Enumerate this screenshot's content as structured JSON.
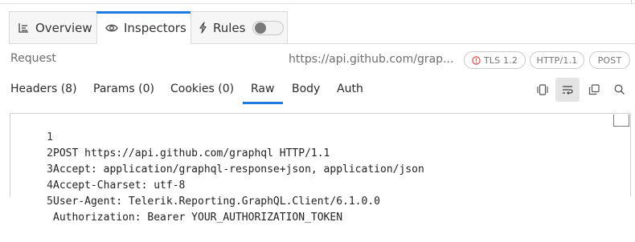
{
  "main_tabs": [
    {
      "label": "Overview",
      "icon": "list-icon"
    },
    {
      "label": "Inspectors",
      "icon": "eye-icon"
    },
    {
      "label": "Rules",
      "icon": "lightning-icon",
      "toggle_on": false
    }
  ],
  "request": {
    "label": "Request",
    "url": "https://api.github.com/grap...",
    "badges": {
      "tls": "TLS 1.2",
      "http": "HTTP/1.1",
      "method": "POST"
    }
  },
  "sub_tabs": [
    "Headers (8)",
    "Params (0)",
    "Cookies (0)",
    "Raw",
    "Body",
    "Auth"
  ],
  "active_sub_tab": "Raw",
  "tools": [
    {
      "icon": "split-view-icon"
    },
    {
      "icon": "word-wrap-icon",
      "active": true
    },
    {
      "icon": "copy-icon"
    },
    {
      "icon": "search-icon"
    }
  ],
  "code_lines": [
    {
      "n": "1",
      "text": "POST https://api.github.com/graphql HTTP/1.1"
    },
    {
      "n": "2",
      "text": "Accept: application/graphql-response+json, application/json"
    },
    {
      "n": "3",
      "text": "Accept-Charset: utf-8"
    },
    {
      "n": "4",
      "text": "User-Agent: Telerik.Reporting.GraphQL.Client/6.1.0.0"
    },
    {
      "n": "5",
      "text": "Authorization: Bearer YOUR_AUTHORIZATION_TOKEN"
    }
  ],
  "colors": {
    "accent": "#1f7ae0",
    "warning": "#d64545"
  }
}
